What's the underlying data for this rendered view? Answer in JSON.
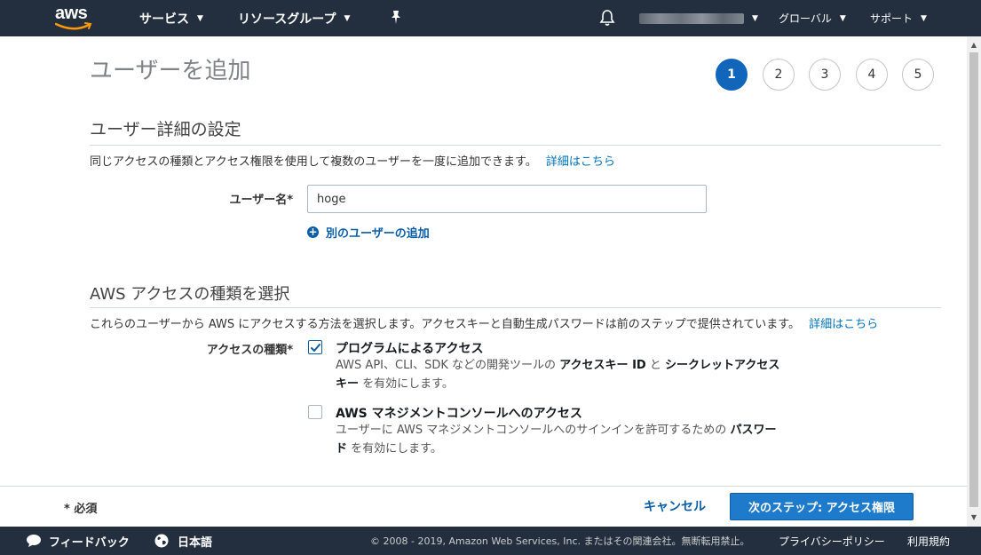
{
  "nav": {
    "logo": "aws",
    "services": "サービス",
    "resource_groups": "リソースグループ",
    "region": "グローバル",
    "support": "サポート",
    "icons": [
      "pin-icon",
      "bell-icon"
    ]
  },
  "page": {
    "title": "ユーザーを追加",
    "steps": [
      "1",
      "2",
      "3",
      "4",
      "5"
    ],
    "active_step": "1"
  },
  "user_details": {
    "title": "ユーザー詳細の設定",
    "description": "同じアクセスの種類とアクセス権限を使用して複数のユーザーを一度に追加できます。",
    "details_link": "詳細はこちら",
    "username_label": "ユーザー名*",
    "username_value": "hoge",
    "add_user_link": "別のユーザーの追加"
  },
  "access_type": {
    "title": "AWS アクセスの種類を選択",
    "description": "これらのユーザーから AWS にアクセスする方法を選択します。アクセスキーと自動生成パスワードは前のステップで提供されています。",
    "details_link": "詳細はこちら",
    "label": "アクセスの種類*",
    "options": [
      {
        "title": "プログラムによるアクセス",
        "checked": true,
        "desc_1": "AWS API、CLI、SDK などの開発ツールの ",
        "desc_1_bold": "アクセスキー ID",
        "desc_2": " と ",
        "desc_2_bold": "シークレットアクセス",
        "desc_3_bold": "キー",
        "desc_3": " を有効にします。"
      },
      {
        "title": "AWS マネジメントコンソールへのアクセス",
        "checked": false,
        "desc_1": "ユーザーに AWS マネジメントコンソールへのサインインを許可するための ",
        "desc_1_bold": "パスワー",
        "desc_2_bold": "ド",
        "desc_2": " を有効にします。"
      }
    ]
  },
  "actions": {
    "required_note": "* 必須",
    "cancel": "キャンセル",
    "next": "次のステップ: アクセス権限"
  },
  "footer": {
    "feedback": "フィードバック",
    "language": "日本語",
    "copyright": "© 2008 - 2019, Amazon Web Services, Inc. またはその関連会社。無断転用禁止。",
    "privacy": "プライバシーポリシー",
    "terms": "利用規約"
  },
  "colors": {
    "nav_bg": "#232f3e",
    "accent": "#1166bb",
    "link": "#0073bb",
    "primary_button": "#1e7bcc",
    "logo_smile": "#ff9900"
  }
}
